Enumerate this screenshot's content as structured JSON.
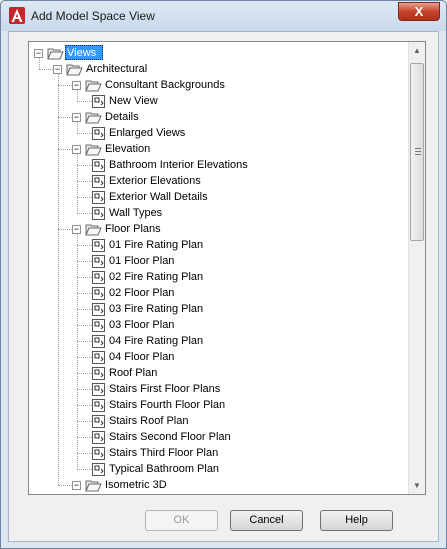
{
  "window": {
    "title": "Add Model Space View",
    "close_glyph": "X"
  },
  "tree": {
    "nodes": [
      {
        "label": "Views",
        "kind": "folder",
        "depth": 0,
        "expanded": true,
        "selected": true
      },
      {
        "label": "Architectural",
        "kind": "folder",
        "depth": 1,
        "expanded": true
      },
      {
        "label": "Consultant Backgrounds",
        "kind": "folder",
        "depth": 2,
        "expanded": true
      },
      {
        "label": "New View",
        "kind": "view",
        "depth": 3
      },
      {
        "label": "Details",
        "kind": "folder",
        "depth": 2,
        "expanded": true
      },
      {
        "label": "Enlarged Views",
        "kind": "view",
        "depth": 3
      },
      {
        "label": "Elevation",
        "kind": "folder",
        "depth": 2,
        "expanded": true
      },
      {
        "label": "Bathroom Interior Elevations",
        "kind": "view",
        "depth": 3
      },
      {
        "label": "Exterior Elevations",
        "kind": "view",
        "depth": 3
      },
      {
        "label": "Exterior Wall Details",
        "kind": "view",
        "depth": 3
      },
      {
        "label": "Wall Types",
        "kind": "view",
        "depth": 3
      },
      {
        "label": "Floor Plans",
        "kind": "folder",
        "depth": 2,
        "expanded": true
      },
      {
        "label": "01 Fire Rating Plan",
        "kind": "view",
        "depth": 3
      },
      {
        "label": "01 Floor Plan",
        "kind": "view",
        "depth": 3
      },
      {
        "label": "02 Fire Rating Plan",
        "kind": "view",
        "depth": 3
      },
      {
        "label": "02 Floor Plan",
        "kind": "view",
        "depth": 3
      },
      {
        "label": "03 Fire Rating Plan",
        "kind": "view",
        "depth": 3
      },
      {
        "label": "03 Floor Plan",
        "kind": "view",
        "depth": 3
      },
      {
        "label": "04 Fire Rating Plan",
        "kind": "view",
        "depth": 3
      },
      {
        "label": "04 Floor Plan",
        "kind": "view",
        "depth": 3
      },
      {
        "label": "Roof Plan",
        "kind": "view",
        "depth": 3
      },
      {
        "label": "Stairs First Floor Plans",
        "kind": "view",
        "depth": 3
      },
      {
        "label": "Stairs Fourth Floor Plan",
        "kind": "view",
        "depth": 3
      },
      {
        "label": "Stairs Roof Plan",
        "kind": "view",
        "depth": 3
      },
      {
        "label": "Stairs Second Floor Plan",
        "kind": "view",
        "depth": 3
      },
      {
        "label": "Stairs Third Floor Plan",
        "kind": "view",
        "depth": 3
      },
      {
        "label": "Typical Bathroom Plan",
        "kind": "view",
        "depth": 3
      },
      {
        "label": "Isometric 3D",
        "kind": "folder",
        "depth": 2,
        "expanded": true
      }
    ]
  },
  "scrollbar": {
    "thumb_fraction": 0.43
  },
  "buttons": {
    "ok_label": "OK",
    "cancel_label": "Cancel",
    "help_label": "Help"
  },
  "colors": {
    "selection": "#3399ff",
    "close_button": "#c7432b",
    "app_icon": "#c4262e"
  }
}
